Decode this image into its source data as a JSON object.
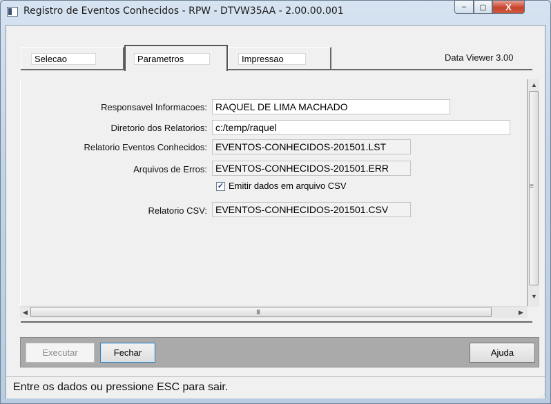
{
  "window": {
    "title": "Registro de Eventos Conhecidos - RPW - DTVW35AA - 2.00.00.001",
    "controls": {
      "minimize": "–",
      "maximize": "▢",
      "close": "X"
    }
  },
  "tabs": [
    {
      "label": "Selecao",
      "active": false
    },
    {
      "label": "Parametros",
      "active": true
    },
    {
      "label": "Impressao",
      "active": false
    }
  ],
  "data_viewer_version": "Data Viewer 3.00",
  "form": {
    "responsavel": {
      "label": "Responsavel Informacoes:",
      "value": "RAQUEL DE LIMA MACHADO"
    },
    "diretorio": {
      "label": "Diretorio dos Relatorios:",
      "value": "c:/temp/raquel"
    },
    "relatorio_eventos": {
      "label": "Relatorio Eventos Conhecidos:",
      "value": "EVENTOS-CONHECIDOS-201501.LST"
    },
    "arquivos_erros": {
      "label": "Arquivos de Erros:",
      "value": "EVENTOS-CONHECIDOS-201501.ERR"
    },
    "emitir_csv": {
      "label": "Emitir dados em arquivo CSV",
      "checked": true,
      "mark": "✓"
    },
    "relatorio_csv": {
      "label": "Relatorio CSV:",
      "value": "EVENTOS-CONHECIDOS-201501.CSV"
    }
  },
  "scrollbars": {
    "grip": "III",
    "grip_vertical": "≡"
  },
  "buttons": {
    "executar": "Executar",
    "fechar": "Fechar",
    "ajuda": "Ajuda"
  },
  "status": {
    "text": "Entre os dados ou pressione ESC para sair."
  },
  "icons": [
    "app-window-icon",
    "minimize-icon",
    "maximize-icon",
    "close-icon",
    "checkbox-check-icon",
    "arrow-up-icon",
    "arrow-down-icon",
    "arrow-left-icon",
    "arrow-right-icon"
  ]
}
